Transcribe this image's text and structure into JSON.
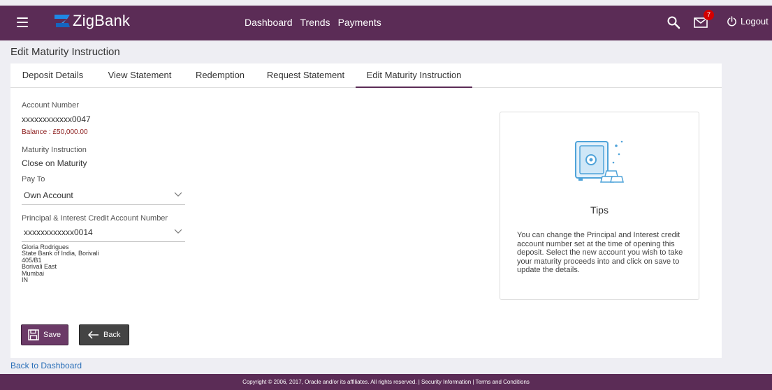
{
  "header": {
    "logo_text": "ZigBank",
    "nav": [
      "Dashboard",
      "Trends",
      "Payments"
    ],
    "notification_count": "7",
    "logout_label": "Logout",
    "bar_color": "#5b2c56"
  },
  "page": {
    "title": "Edit Maturity Instruction"
  },
  "tabs": [
    {
      "label": "Deposit Details",
      "active": false
    },
    {
      "label": "View Statement",
      "active": false
    },
    {
      "label": "Redemption",
      "active": false
    },
    {
      "label": "Request Statement",
      "active": false
    },
    {
      "label": "Edit Maturity Instruction",
      "active": true
    }
  ],
  "form": {
    "account_number_label": "Account Number",
    "account_number_value": "xxxxxxxxxxxx0047",
    "balance": "Balance : £50,000.00",
    "maturity_instruction_label": "Maturity Instruction",
    "maturity_instruction_value": "Close on Maturity",
    "pay_to_label": "Pay To",
    "pay_to_value": "Own Account",
    "credit_account_label": "Principal & Interest Credit Account Number",
    "credit_account_value": "xxxxxxxxxxxx0014",
    "address": [
      "Gloria Rodrigues",
      "State Bank of India, Borivali",
      "405/B1",
      "Borivali East",
      "Mumbai",
      "IN"
    ]
  },
  "buttons": {
    "save_label": "Save",
    "back_label": "Back"
  },
  "tips": {
    "title": "Tips",
    "text": "You can change the Principal and Interest credit account number set at the time of opening this deposit. Select the new account you wish to take your maturity proceeds into and click on save to update the details."
  },
  "links": {
    "back_to_dashboard": "Back to Dashboard"
  },
  "footer": {
    "text": "Copyright © 2006, 2017, Oracle and/or its affiliates. All rights reserved. | Security Information | Terms and Conditions"
  }
}
